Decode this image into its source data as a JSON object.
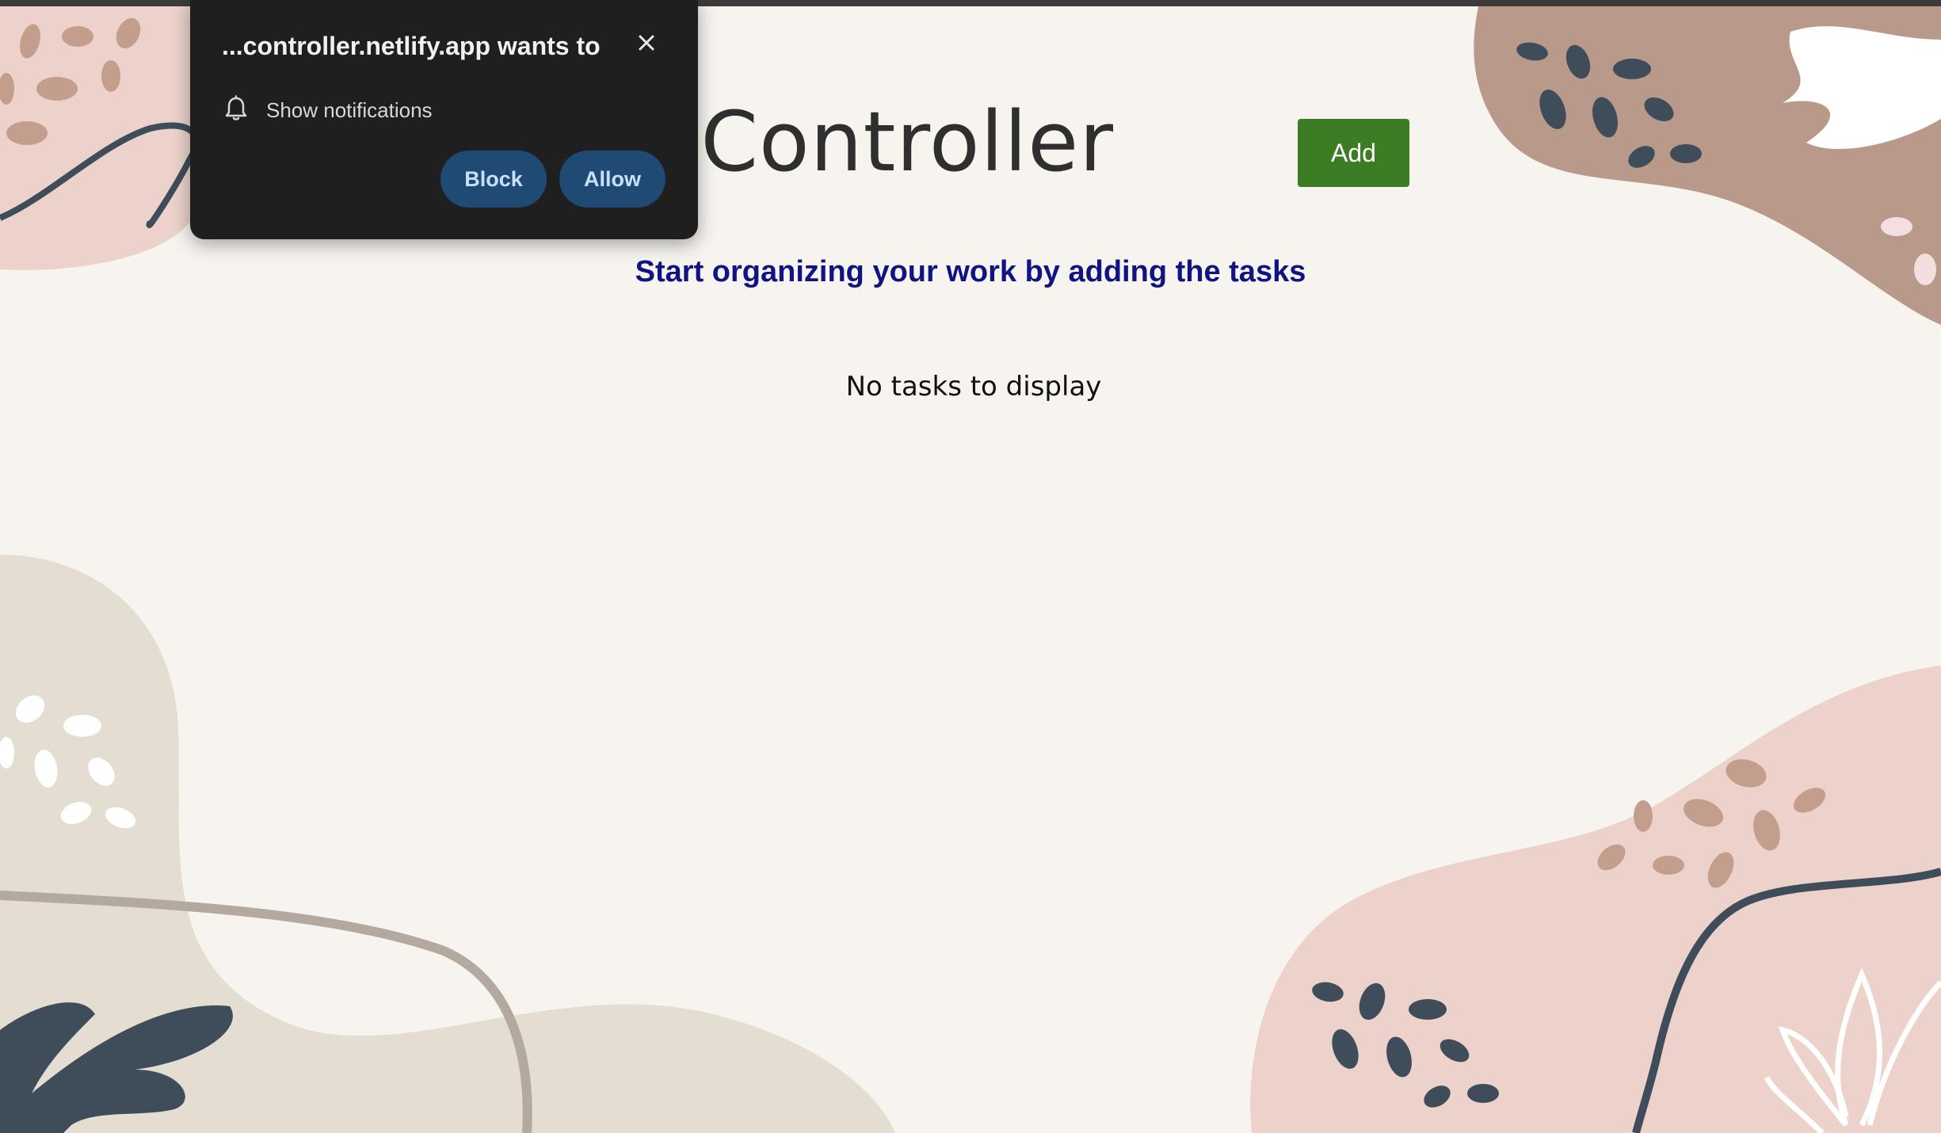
{
  "app": {
    "title": "To-do Controller",
    "visible_title": "o Controller",
    "add_label": "Add",
    "subtitle": "Start organizing your work by adding the tasks",
    "empty_message": "No tasks to display"
  },
  "permission_prompt": {
    "title": "...controller.netlify.app wants to",
    "permission": "Show notifications",
    "block_label": "Block",
    "allow_label": "Allow"
  },
  "icons": {
    "close": "close-icon",
    "bell": "bell-icon"
  },
  "colors": {
    "background": "#f7f4ef",
    "accent_green": "#3b7c25",
    "subtitle_blue": "#101483",
    "popup_bg": "#1f1f1f",
    "popup_button": "#1e4a74"
  }
}
